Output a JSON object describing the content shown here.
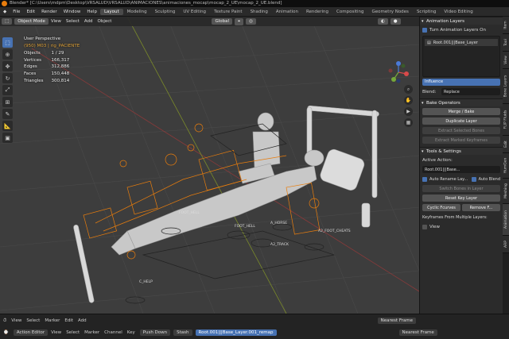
{
  "window": {
    "title": "Blender* [C:\\Users\\mdpm\\Desktop\\VRSALUD\\VRSALUD\\ANIMACIONES\\animaciones_mocap\\mocap_2_UE\\mocap_2_UE.blend]"
  },
  "menu": [
    "File",
    "Edit",
    "Render",
    "Window",
    "Help"
  ],
  "workspaces": [
    "Layout",
    "Modeling",
    "Sculpting",
    "UV Editing",
    "Texture Paint",
    "Shading",
    "Animation",
    "Rendering",
    "Compositing",
    "Geometry Nodes",
    "Scripting",
    "Video Editing"
  ],
  "active_workspace": "Layout",
  "viewport": {
    "mode": "Object Mode",
    "menus": [
      "View",
      "Select",
      "Add",
      "Object"
    ],
    "orientation": "Global",
    "perspective": "User Perspective",
    "collection_line": "(950) M03 | rig_PACIENTE",
    "stats": [
      {
        "label": "Objects",
        "value": "1 / 29"
      },
      {
        "label": "Vertices",
        "value": "166,317"
      },
      {
        "label": "Edges",
        "value": "312,886"
      },
      {
        "label": "Faces",
        "value": "150,448"
      },
      {
        "label": "Triangles",
        "value": "300,814"
      }
    ],
    "object_labels": [
      "FOOT_HELL",
      "FOOT_HELL",
      "A_HORSE",
      "A2_FOOT_CHEATS",
      "A2_TRACK",
      "C_HELP"
    ],
    "tools": [
      "select",
      "cursor",
      "move",
      "rotate",
      "scale",
      "transform",
      "annotate",
      "measure",
      "add-cube"
    ]
  },
  "animation_layers": {
    "header": "Animation Layers",
    "turn_on_label": "Turn Animation Layers On",
    "turn_on_checked": true,
    "layers": [
      "Root.001|||Base_Layer"
    ],
    "influence_label": "Influence",
    "influence_value": "1.000",
    "blend_label": "Blend:",
    "blend_value": "Replace"
  },
  "bake_operators": {
    "header": "Bake Operators",
    "merge": "Merge / Bake",
    "duplicate": "Duplicate Layer",
    "extract_bones": "Extract Selected Bones",
    "extract_markers": "Extract Marked Keyframes"
  },
  "tools_settings": {
    "header": "Tools & Settings",
    "active_action_label": "Active Action:",
    "active_action": "Root.001|||Base...",
    "auto_rename": "Auto Rename Lay...",
    "auto_blend": "Auto Blend",
    "switch_bones": "Switch Bones in Layer",
    "reset_key": "Reset Key Layer",
    "cyclic": "Cyclic Fcurves",
    "remove_fcurves": "Remove F...",
    "keyframes_label": "Keyframes From Multiple Layers:",
    "view_label": "View"
  },
  "sidebar_tabs": [
    "Item",
    "Tool",
    "View",
    "Bone Layers",
    "FLIP Fluids",
    "Edit",
    "HumGen",
    "Meshing",
    "Animation",
    "ARP"
  ],
  "timeline_header": {
    "menus": [
      "View",
      "Select",
      "Marker",
      "Edit",
      "Add"
    ]
  },
  "action_editor": {
    "editor": "Action Editor",
    "menus": [
      "View",
      "Select",
      "Marker",
      "Channel",
      "Key"
    ],
    "push_down": "Push Down",
    "stash": "Stash",
    "action": "Root.001|||Base_Layer.001_remap",
    "snapping": "Nearest Frame"
  },
  "top_right_snapping": "Nearest Frame",
  "colors": {
    "accent": "#4772b3",
    "selection": "#e87d0d",
    "viewport": "#3d3d3d"
  }
}
